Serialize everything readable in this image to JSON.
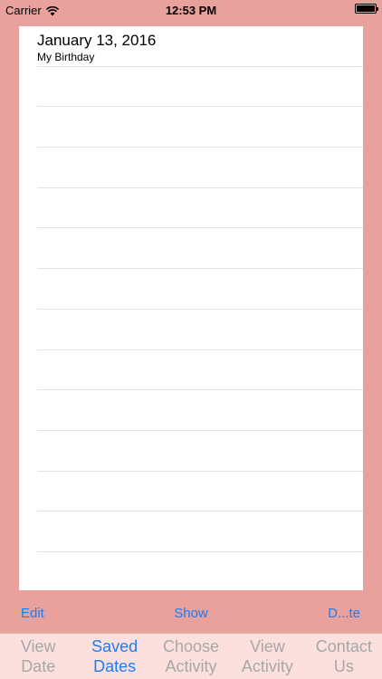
{
  "status_bar": {
    "carrier": "Carrier",
    "time": "12:53 PM"
  },
  "list": {
    "items": [
      {
        "title": "January 13, 2016",
        "subtitle": "My Birthday"
      }
    ]
  },
  "toolbar": {
    "edit_label": "Edit",
    "show_label": "Show",
    "delete_label": "D...te"
  },
  "tabs": [
    {
      "line1": "View",
      "line2": "Date",
      "active": false
    },
    {
      "line1": "Saved",
      "line2": "Dates",
      "active": true
    },
    {
      "line1": "Choose",
      "line2": "Activity",
      "active": false
    },
    {
      "line1": "View",
      "line2": "Activity",
      "active": false
    },
    {
      "line1": "Contact",
      "line2": "Us",
      "active": false
    }
  ],
  "colors": {
    "background": "#E8A19C",
    "tab_bar": "#FCE0DE",
    "accent": "#1E7CF2",
    "inactive_tab": "#A7A7A7"
  }
}
